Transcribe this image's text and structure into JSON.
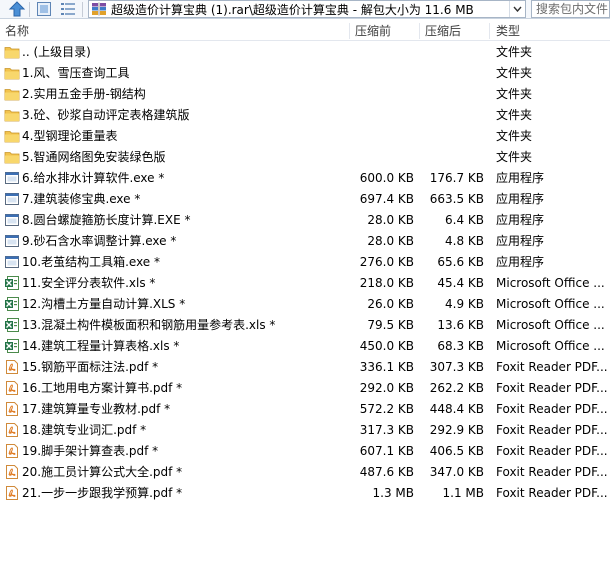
{
  "toolbar": {
    "address": "超级造价计算宝典 (1).rar\\超级造价计算宝典 - 解包大小为 11.6 MB",
    "search_placeholder": "搜索包内文件"
  },
  "columns": {
    "name": "名称",
    "packed": "压缩前",
    "size": "压缩后",
    "type": "类型"
  },
  "rows": [
    {
      "name": ".. (上级目录)",
      "packed": "",
      "size": "",
      "type": "文件夹",
      "icon": "folder"
    },
    {
      "name": "1.风、雪压查询工具",
      "packed": "",
      "size": "",
      "type": "文件夹",
      "icon": "folder"
    },
    {
      "name": "2.实用五金手册-钢结构",
      "packed": "",
      "size": "",
      "type": "文件夹",
      "icon": "folder"
    },
    {
      "name": "3.砼、砂浆自动评定表格建筑版",
      "packed": "",
      "size": "",
      "type": "文件夹",
      "icon": "folder"
    },
    {
      "name": "4.型钢理论重量表",
      "packed": "",
      "size": "",
      "type": "文件夹",
      "icon": "folder"
    },
    {
      "name": "5.智通网络图免安装绿色版",
      "packed": "",
      "size": "",
      "type": "文件夹",
      "icon": "folder"
    },
    {
      "name": "6.给水排水计算软件.exe *",
      "packed": "600.0 KB",
      "size": "176.7 KB",
      "type": "应用程序",
      "icon": "exe"
    },
    {
      "name": "7.建筑装修宝典.exe *",
      "packed": "697.4 KB",
      "size": "663.5 KB",
      "type": "应用程序",
      "icon": "exe"
    },
    {
      "name": "8.圆台螺旋箍筋长度计算.EXE *",
      "packed": "28.0 KB",
      "size": "6.4 KB",
      "type": "应用程序",
      "icon": "exe"
    },
    {
      "name": "9.砂石含水率调整计算.exe *",
      "packed": "28.0 KB",
      "size": "4.8 KB",
      "type": "应用程序",
      "icon": "exe"
    },
    {
      "name": "10.老茧结构工具箱.exe *",
      "packed": "276.0 KB",
      "size": "65.6 KB",
      "type": "应用程序",
      "icon": "exe"
    },
    {
      "name": "11.安全评分表软件.xls *",
      "packed": "218.0 KB",
      "size": "45.4 KB",
      "type": "Microsoft Office ...",
      "icon": "xls"
    },
    {
      "name": "12.沟槽土方量自动计算.XLS *",
      "packed": "26.0 KB",
      "size": "4.9 KB",
      "type": "Microsoft Office ...",
      "icon": "xls"
    },
    {
      "name": "13.混凝土构件模板面积和钢筋用量参考表.xls *",
      "packed": "79.5 KB",
      "size": "13.6 KB",
      "type": "Microsoft Office ...",
      "icon": "xls"
    },
    {
      "name": "14.建筑工程量计算表格.xls *",
      "packed": "450.0 KB",
      "size": "68.3 KB",
      "type": "Microsoft Office ...",
      "icon": "xls"
    },
    {
      "name": "15.钢筋平面标注法.pdf *",
      "packed": "336.1 KB",
      "size": "307.3 KB",
      "type": "Foxit Reader PDF...",
      "icon": "pdf"
    },
    {
      "name": "16.工地用电方案计算书.pdf *",
      "packed": "292.0 KB",
      "size": "262.2 KB",
      "type": "Foxit Reader PDF...",
      "icon": "pdf"
    },
    {
      "name": "17.建筑算量专业教材.pdf *",
      "packed": "572.2 KB",
      "size": "448.4 KB",
      "type": "Foxit Reader PDF...",
      "icon": "pdf"
    },
    {
      "name": "18.建筑专业词汇.pdf *",
      "packed": "317.3 KB",
      "size": "292.9 KB",
      "type": "Foxit Reader PDF...",
      "icon": "pdf"
    },
    {
      "name": "19.脚手架计算查表.pdf *",
      "packed": "607.1 KB",
      "size": "406.5 KB",
      "type": "Foxit Reader PDF...",
      "icon": "pdf"
    },
    {
      "name": "20.施工员计算公式大全.pdf *",
      "packed": "487.6 KB",
      "size": "347.0 KB",
      "type": "Foxit Reader PDF...",
      "icon": "pdf"
    },
    {
      "name": "21.一步一步跟我学预算.pdf *",
      "packed": "1.3 MB",
      "size": "1.1 MB",
      "type": "Foxit Reader PDF...",
      "icon": "pdf"
    }
  ]
}
